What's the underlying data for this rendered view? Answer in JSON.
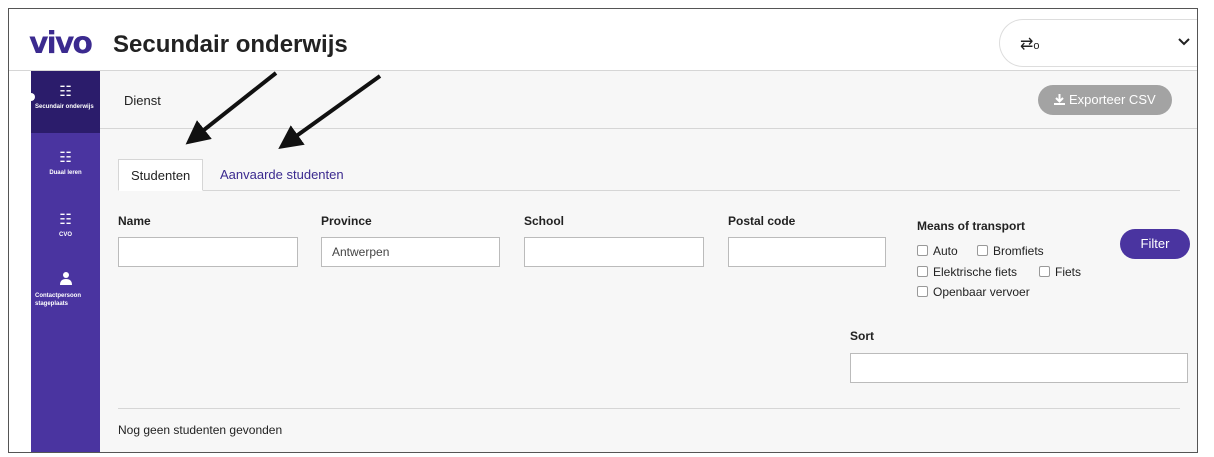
{
  "header": {
    "logo_text": "vivo",
    "title": "Secundair onderwijs",
    "role_switch_icon": "⇄",
    "role_switch_value": "o",
    "chevron": "⌄"
  },
  "sidebar": {
    "items": [
      {
        "label": "Secundair onderwijs",
        "icon": "list-icon",
        "active": true
      },
      {
        "label": "Duaal leren",
        "icon": "list-icon",
        "active": false
      },
      {
        "label": "CVO",
        "icon": "list-icon",
        "active": false
      },
      {
        "label": "Contactpersoon stageplaats",
        "icon": "user-icon",
        "active": false
      }
    ]
  },
  "subbar": {
    "label": "Dienst",
    "export_label": "Exporteer CSV",
    "export_icon": "download-icon"
  },
  "tabs": [
    {
      "label": "Studenten",
      "active": true
    },
    {
      "label": "Aanvaarde studenten",
      "active": false
    }
  ],
  "filters": {
    "name_label": "Name",
    "name_value": "",
    "province_label": "Province",
    "province_value": "Antwerpen",
    "school_label": "School",
    "school_value": "",
    "postal_label": "Postal code",
    "postal_value": "",
    "transport_label": "Means of transport",
    "transport_options": [
      "Auto",
      "Bromfiets",
      "Elektrische fiets",
      "Fiets",
      "Openbaar vervoer"
    ],
    "filter_button": "Filter",
    "sort_label": "Sort",
    "sort_value": ""
  },
  "results": {
    "empty_message": "Nog geen studenten gevonden"
  },
  "colors": {
    "brand": "#4a34a0",
    "sidebar_active": "#2b1c6b",
    "export_disabled": "#a3a3a3"
  }
}
